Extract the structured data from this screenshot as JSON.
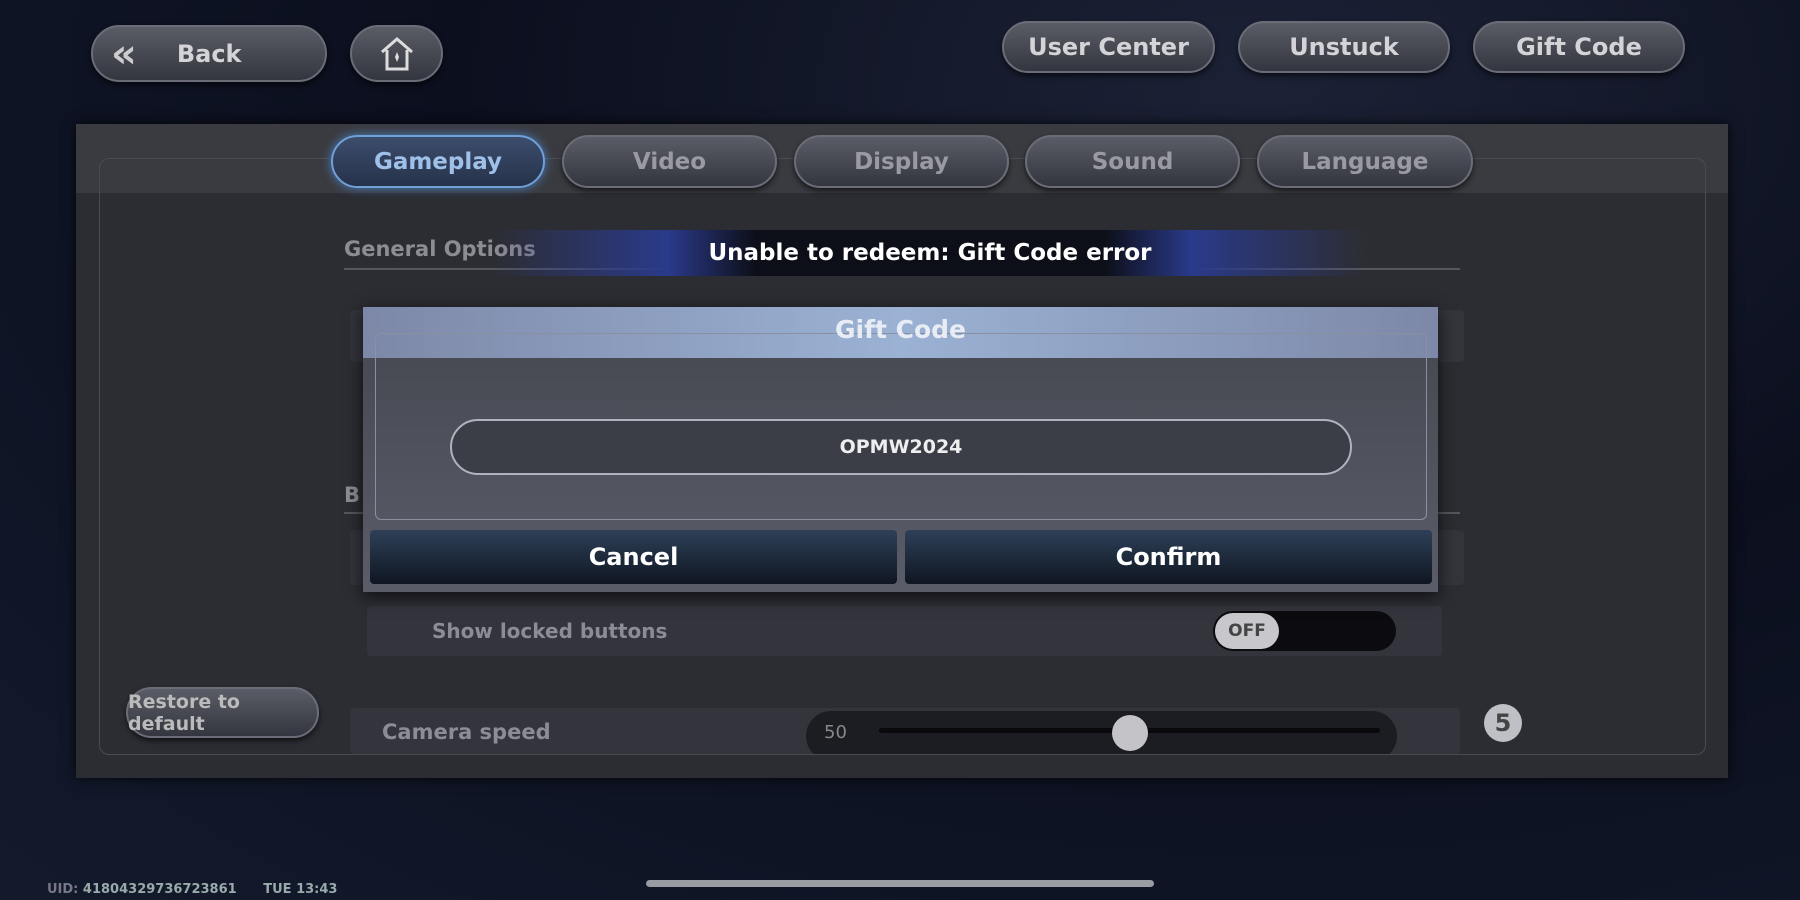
{
  "topbar": {
    "back_label": "Back",
    "home_icon": "home-icon",
    "user_center": "User Center",
    "unstuck": "Unstuck",
    "gift_code": "Gift Code"
  },
  "tabs": [
    {
      "label": "Gameplay",
      "active": true
    },
    {
      "label": "Video"
    },
    {
      "label": "Display"
    },
    {
      "label": "Sound"
    },
    {
      "label": "Language"
    }
  ],
  "settings": {
    "section_general": "General Options",
    "section_b": "B",
    "show_locked_label": "Show locked buttons",
    "show_locked_state": "OFF",
    "camera_speed_label": "Camera speed",
    "camera_speed_value": "50",
    "camera_speed_fraction": 0.5,
    "badge": "5",
    "restore_label": "Restore to default"
  },
  "toast": {
    "message": "Unable to redeem: Gift Code error"
  },
  "dialog": {
    "title": "Gift Code",
    "input_value": "OPMW2024",
    "cancel_label": "Cancel",
    "confirm_label": "Confirm"
  },
  "footer": {
    "uid_label": "UID:",
    "uid_value": "41804329736723861",
    "time": "TUE 13:43"
  }
}
